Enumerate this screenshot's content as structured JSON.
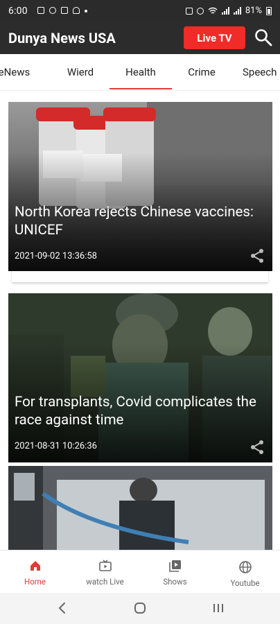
{
  "status_bar": {
    "time": "6:00",
    "battery": "81%",
    "icons": [
      "gallery-icon",
      "ghost-icon",
      "upload-icon",
      "notification-bell-icon",
      "dot-icon",
      "lock-icon",
      "alarm-icon",
      "wifi-icon",
      "signal-icon",
      "signal-icon",
      "battery-icon"
    ]
  },
  "app_bar": {
    "title": "Dunya News USA",
    "live_button": "Live TV",
    "search_icon": "search-icon",
    "live_color": "#f02b28"
  },
  "tabs": {
    "items": [
      {
        "label": "FakeNews"
      },
      {
        "label": "Wierd"
      },
      {
        "label": "Health",
        "active": true
      },
      {
        "label": "Crime"
      },
      {
        "label": "Speech"
      }
    ],
    "accent": "#e53935"
  },
  "feed": {
    "articles": [
      {
        "headline": "North Korea rejects Chinese vaccines: UNICEF",
        "date": "2021-09-02 13:36:58",
        "share_icon": "share-icon"
      },
      {
        "headline": "For transplants, Covid complicates the race against time",
        "date": "2021-08-31 10:26:36",
        "share_icon": "share-icon"
      },
      {
        "headline": "",
        "date": ""
      }
    ]
  },
  "bottom_nav": {
    "items": [
      {
        "label": "Home",
        "icon": "home-icon",
        "active": true
      },
      {
        "label": "watch Live",
        "icon": "tv-icon"
      },
      {
        "label": "Shows",
        "icon": "video-library-icon"
      },
      {
        "label": "Youtube",
        "icon": "globe-icon"
      }
    ]
  },
  "system_nav": [
    "back-icon",
    "home-circle-icon",
    "recents-icon"
  ]
}
